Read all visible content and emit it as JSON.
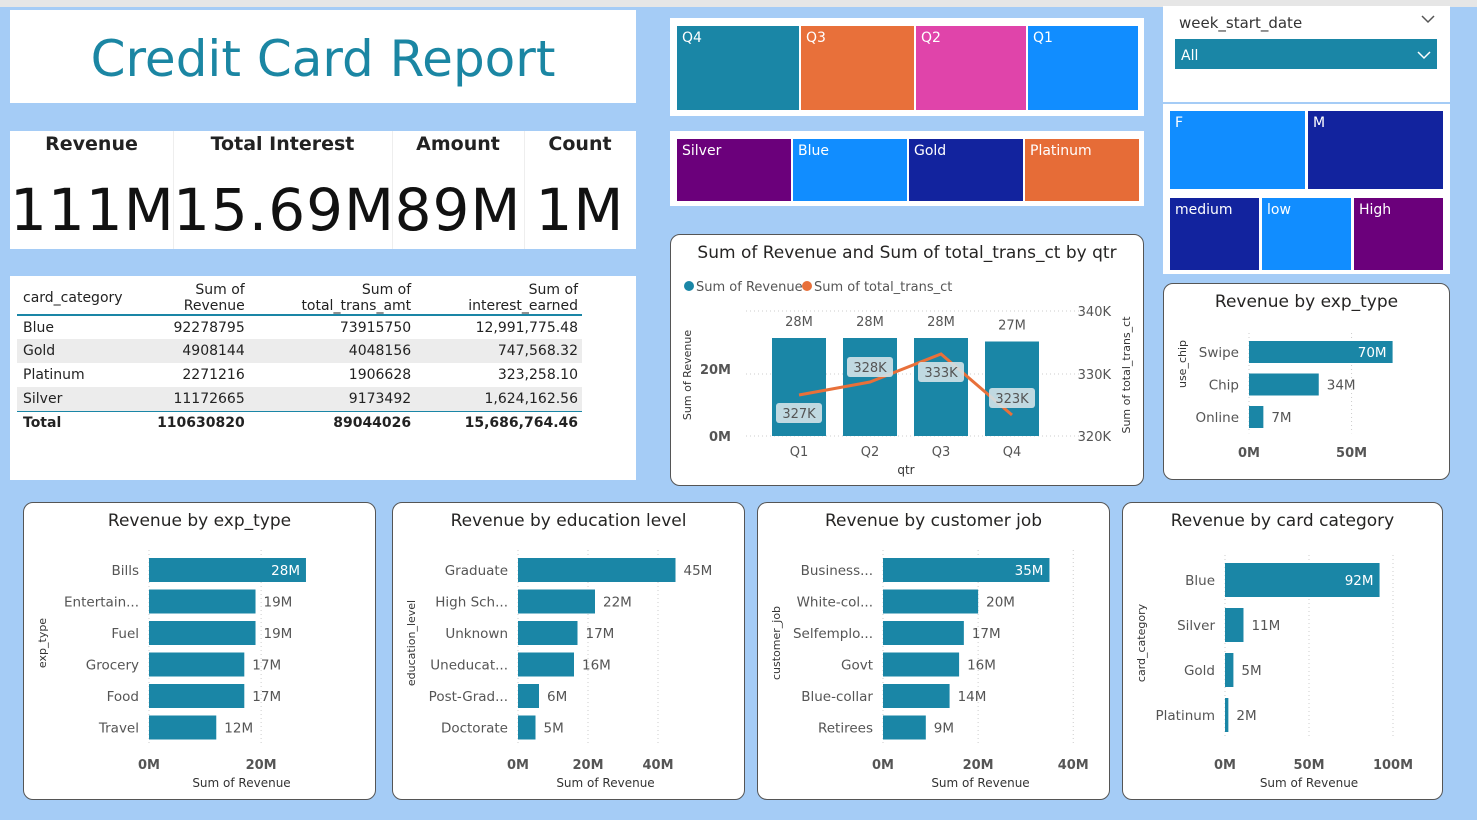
{
  "report_title": "Credit Card Report",
  "kpis": [
    {
      "label": "Revenue",
      "value": "111M"
    },
    {
      "label": "Total Interest",
      "value": "15.69M"
    },
    {
      "label": "Amount",
      "value": "89M"
    },
    {
      "label": "Count",
      "value": "1M"
    }
  ],
  "table": {
    "headers": [
      "card_category",
      "Sum of Revenue",
      "Sum of total_trans_amt",
      "Sum of interest_earned"
    ],
    "rows": [
      [
        "Blue",
        "92278795",
        "73915750",
        "12,991,775.48"
      ],
      [
        "Gold",
        "4908144",
        "4048156",
        "747,568.32"
      ],
      [
        "Platinum",
        "2271216",
        "1906628",
        "323,258.10"
      ],
      [
        "Silver",
        "11172665",
        "9173492",
        "1,624,162.56"
      ]
    ],
    "total": [
      "Total",
      "110630820",
      "89044026",
      "15,686,764.46"
    ]
  },
  "slicers": {
    "quarters": [
      {
        "label": "Q4",
        "color": "#1a86a6"
      },
      {
        "label": "Q3",
        "color": "#e8703a"
      },
      {
        "label": "Q2",
        "color": "#e044aa"
      },
      {
        "label": "Q1",
        "color": "#118dff"
      }
    ],
    "card_categories": [
      {
        "label": "Silver",
        "color": "#6b007b"
      },
      {
        "label": "Blue",
        "color": "#118dff"
      },
      {
        "label": "Gold",
        "color": "#12239e"
      },
      {
        "label": "Platinum",
        "color": "#e66c37"
      }
    ],
    "gender": [
      {
        "label": "F",
        "color": "#118dff"
      },
      {
        "label": "M",
        "color": "#12239e"
      }
    ],
    "income": [
      {
        "label": "medium",
        "color": "#12239e"
      },
      {
        "label": "low",
        "color": "#118dff"
      },
      {
        "label": "High",
        "color": "#6b007b"
      }
    ],
    "week_start_date": {
      "label": "week_start_date",
      "selected": "All"
    }
  },
  "chart_data": [
    {
      "id": "combo",
      "type": "bar+line",
      "title": "Sum of Revenue and Sum of total_trans_ct by qtr",
      "legend": [
        "Sum of Revenue",
        "Sum of total_trans_ct"
      ],
      "categories": [
        "Q1",
        "Q2",
        "Q3",
        "Q4"
      ],
      "bar_series": {
        "name": "Sum of Revenue",
        "values": [
          28,
          28,
          28,
          27
        ],
        "labels": [
          "28M",
          "28M",
          "28M",
          "27M"
        ],
        "color": "#1a86a6"
      },
      "line_series": {
        "name": "Sum of total_trans_ct",
        "values": [
          327,
          328,
          333,
          323
        ],
        "labels": [
          "327K",
          "328K",
          "333K",
          "323K"
        ],
        "color": "#e8703a"
      },
      "xlabel": "qtr",
      "ylabel": "Sum of Revenue",
      "y2label": "Sum of total_trans_ct",
      "yticks": [
        "0M",
        "20M"
      ],
      "y2ticks": [
        "320K",
        "330K",
        "340K"
      ],
      "ylim": [
        0,
        30
      ],
      "y2lim": [
        320,
        340
      ]
    },
    {
      "id": "use_chip",
      "type": "bar",
      "orientation": "horizontal",
      "title": "Revenue by exp_type",
      "ylabel": "use_chip",
      "categories": [
        "Swipe",
        "Chip",
        "Online"
      ],
      "values": [
        70,
        34,
        7
      ],
      "labels": [
        "70M",
        "34M",
        "7M"
      ],
      "xticks": [
        "0M",
        "50M"
      ],
      "xtick_values": [
        0,
        50
      ],
      "xlim": [
        0,
        78
      ]
    },
    {
      "id": "exp_type",
      "type": "bar",
      "orientation": "horizontal",
      "title": "Revenue by exp_type",
      "ylabel": "exp_type",
      "xlabel": "Sum of Revenue",
      "categories": [
        "Bills",
        "Entertain...",
        "Fuel",
        "Grocery",
        "Food",
        "Travel"
      ],
      "values": [
        28,
        19,
        19,
        17,
        17,
        12
      ],
      "labels": [
        "28M",
        "19M",
        "19M",
        "17M",
        "17M",
        "12M"
      ],
      "xticks": [
        "0M",
        "20M"
      ],
      "xtick_values": [
        0,
        20
      ],
      "xlim": [
        0,
        33
      ]
    },
    {
      "id": "education",
      "type": "bar",
      "orientation": "horizontal",
      "title": "Revenue by education level",
      "ylabel": "education_level",
      "xlabel": "Sum of Revenue",
      "categories": [
        "Graduate",
        "High Sch...",
        "Unknown",
        "Uneducat...",
        "Post-Grad...",
        "Doctorate"
      ],
      "values": [
        45,
        22,
        17,
        16,
        6,
        5
      ],
      "labels": [
        "45M",
        "22M",
        "17M",
        "16M",
        "6M",
        "5M"
      ],
      "xticks": [
        "0M",
        "20M",
        "40M"
      ],
      "xtick_values": [
        0,
        20,
        40
      ],
      "xlim": [
        0,
        50
      ]
    },
    {
      "id": "job",
      "type": "bar",
      "orientation": "horizontal",
      "title": "Revenue by customer job",
      "ylabel": "customer_job",
      "xlabel": "Sum of Revenue",
      "categories": [
        "Business...",
        "White-col...",
        "Selfemplo...",
        "Govt",
        "Blue-collar",
        "Retirees"
      ],
      "values": [
        35,
        20,
        17,
        16,
        14,
        9
      ],
      "labels": [
        "35M",
        "20M",
        "17M",
        "16M",
        "14M",
        "9M"
      ],
      "xticks": [
        "0M",
        "20M",
        "40M"
      ],
      "xtick_values": [
        0,
        20,
        40
      ],
      "xlim": [
        0,
        41
      ]
    },
    {
      "id": "card_cat",
      "type": "bar",
      "orientation": "horizontal",
      "title": "Revenue by card category",
      "ylabel": "card_category",
      "xlabel": "Sum of Revenue",
      "categories": [
        "Blue",
        "Silver",
        "Gold",
        "Platinum"
      ],
      "values": [
        92,
        11,
        5,
        2
      ],
      "labels": [
        "92M",
        "11M",
        "5M",
        "2M"
      ],
      "xticks": [
        "0M",
        "50M",
        "100M"
      ],
      "xtick_values": [
        0,
        50,
        100
      ],
      "xlim": [
        0,
        100
      ]
    }
  ],
  "colors": {
    "bar": "#1a86a6",
    "line": "#e8703a",
    "background": "#a5ccf6"
  }
}
